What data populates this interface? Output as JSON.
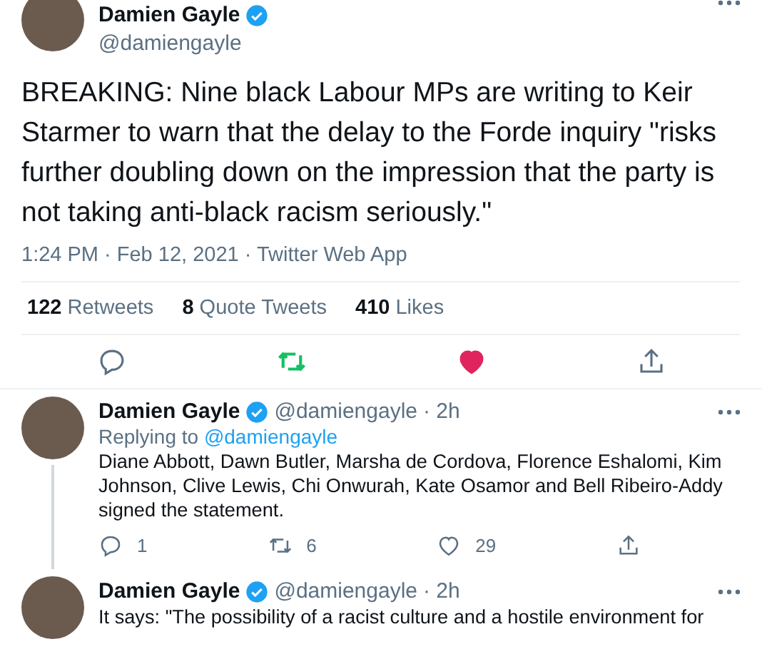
{
  "tweet": {
    "author": {
      "name": "Damien Gayle",
      "handle": "@damiengayle",
      "verified": true
    },
    "text": "BREAKING: Nine black Labour MPs are writing to Keir Starmer to warn that the delay to the Forde inquiry \"risks further doubling down on the impression that the party is not taking anti-black racism seriously.\"",
    "meta": "1:24 PM · Feb 12, 2021 · Twitter Web App",
    "stats": [
      {
        "count": "122",
        "label": "Retweets"
      },
      {
        "count": "8",
        "label": "Quote Tweets"
      },
      {
        "count": "410",
        "label": "Likes"
      }
    ],
    "retweeted": true,
    "liked": true
  },
  "replies": [
    {
      "name": "Damien Gayle",
      "handle": "@damiengayle",
      "time": "· 2h",
      "verified": true,
      "replying_prefix": "Replying to",
      "replying_handle": "@damiengayle",
      "text": "Diane Abbott, Dawn Butler, Marsha de Cordova, Florence Eshalomi, Kim Johnson, Clive Lewis, Chi Onwurah, Kate Osamor and Bell Ribeiro-Addy signed the statement.",
      "counts": {
        "replies": "1",
        "retweets": "6",
        "likes": "29"
      }
    },
    {
      "name": "Damien Gayle",
      "handle": "@damiengayle",
      "time": "· 2h",
      "verified": true,
      "text": "It says: \"The possibility of a racist culture and a hostile environment for"
    }
  ]
}
